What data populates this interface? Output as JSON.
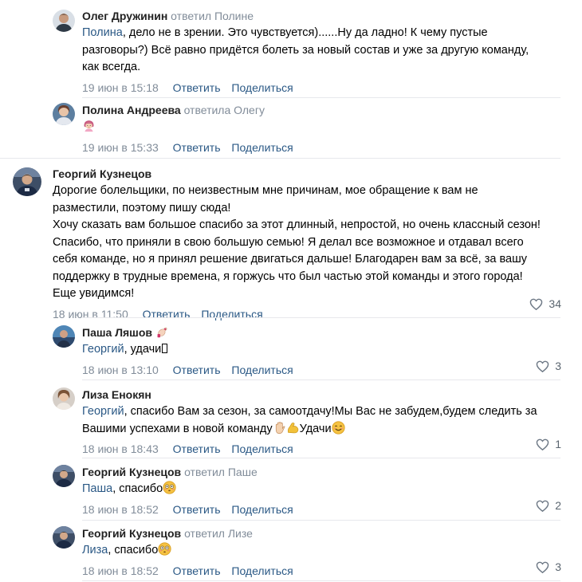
{
  "comments": [
    {
      "author": "Олег Дружинин",
      "reply_note": "ответил",
      "reply_target": "Полине",
      "mention": "Полина",
      "text_lines": [
        ", дело не в зрении. Это чувствуется)......Ну да ладно! К чему пустые",
        "разговоры?) Всё равно придётся болеть за новый состав и уже за другую команду,",
        "как всегда."
      ],
      "date": "19 июн в 15:18",
      "reply_label": "Ответить",
      "share_label": "Поделиться"
    },
    {
      "author": "Полина Андреева",
      "reply_note": "ответила",
      "reply_target": "Олегу",
      "emoji": "woman-emoji",
      "date": "19 июн в 15:33",
      "reply_label": "Ответить",
      "share_label": "Поделиться"
    },
    {
      "author": "Георгий Кузнецов",
      "text_lines": [
        "Дорогие болельщики, по неизвестным мне причинам, мое обращение к вам не",
        "разместили, поэтому пишу сюда!",
        "Хочу сказать вам большое спасибо за этот длинный, непростой, но очень классный сезон!",
        "Спасибо, что приняли в свою большую семью! Я делал все возможное и отдавал всего",
        "себя команде, но я принял решение двигаться дальше! Благодарен вам за всё, за вашу",
        "поддержку в трудные времена, я горжусь что был частью этой команды и этого города!",
        "Еще увидимся!"
      ],
      "date": "18 июн в 11:50",
      "reply_label": "Ответить",
      "share_label": "Поделиться",
      "likes": "34"
    },
    {
      "author": "Паша Ляшов",
      "author_emoji": "nail-polish-emoji",
      "mention": "Георгий",
      "text": ", удачи",
      "date": "18 июн в 13:10",
      "reply_label": "Ответить",
      "share_label": "Поделиться",
      "likes": "3"
    },
    {
      "author": "Лиза Енокян",
      "mention": "Георгий",
      "text_lines": [
        ", спасибо Вам за сезон, за самоотдачу!Мы Вас не забудем,будем следить за",
        "Вашими успехами в новой команду"
      ],
      "tail_text": "Удачи",
      "emojis": [
        "raised-hand-emoji",
        "flexed-biceps-emoji",
        "smiling-face-emoji"
      ],
      "date": "18 июн в 18:43",
      "reply_label": "Ответить",
      "share_label": "Поделиться",
      "likes": "1"
    },
    {
      "author": "Георгий Кузнецов",
      "reply_note": "ответил",
      "reply_target": "Паше",
      "mention": "Паша",
      "text": ", спасибо",
      "emoji": "flushed-face-emoji",
      "date": "18 июн в 18:52",
      "reply_label": "Ответить",
      "share_label": "Поделиться",
      "likes": "2"
    },
    {
      "author": "Георгий Кузнецов",
      "reply_note": "ответил",
      "reply_target": "Лизе",
      "mention": "Лиза",
      "text": ", спасибо",
      "emoji": "flushed-face-emoji",
      "date": "18 июн в 18:52",
      "reply_label": "Ответить",
      "share_label": "Поделиться",
      "likes": "3"
    }
  ],
  "colors": {
    "link": "#2a5885",
    "secondary": "#818c99",
    "divider": "#e7e8ec"
  }
}
